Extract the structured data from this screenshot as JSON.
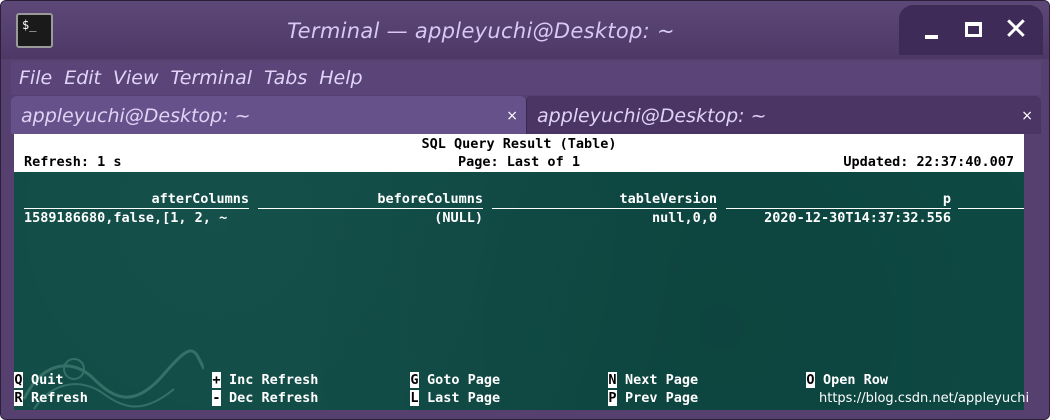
{
  "window": {
    "title": "Terminal — appleyuchi@Desktop: ~",
    "icon_text_line1": "$_",
    "icon_text_line2": "",
    "controls": {
      "minimize": "minimize-icon",
      "maximize": "maximize-icon",
      "close": "✕"
    }
  },
  "menu": [
    "File",
    "Edit",
    "View",
    "Terminal",
    "Tabs",
    "Help"
  ],
  "tabs": [
    {
      "label": "appleyuchi@Desktop: ~",
      "close": "×"
    },
    {
      "label": "appleyuchi@Desktop: ~",
      "close": "×"
    }
  ],
  "query_header": {
    "title": "SQL Query Result (Table)",
    "refresh": "Refresh: 1 s",
    "page": "Page: Last of 1",
    "updated": "Updated: 22:37:40.007"
  },
  "table": {
    "columns": [
      "afterColumns",
      "beforeColumns",
      "tableVersion",
      "p"
    ],
    "rows": [
      [
        "1589186680,false,[1, 2, ~",
        "(NULL)",
        "null,0,0",
        "2020-12-30T14:37:32.556"
      ]
    ]
  },
  "footer": {
    "keys": [
      {
        "key": "Q",
        "label": "Quit"
      },
      {
        "key": "R",
        "label": "Refresh"
      },
      {
        "key": "+",
        "label": "Inc Refresh"
      },
      {
        "key": "-",
        "label": "Dec Refresh"
      },
      {
        "key": "G",
        "label": "Goto Page"
      },
      {
        "key": "L",
        "label": "Last Page"
      },
      {
        "key": "N",
        "label": "Next Page"
      },
      {
        "key": "P",
        "label": "Prev Page"
      },
      {
        "key": "O",
        "label": "Open Row"
      }
    ]
  },
  "watermark": "https://blog.csdn.net/appleyuchi",
  "colors": {
    "frame": "#564070",
    "terminal_bg": "#0e4a44",
    "title_text": "#d8c8f5"
  }
}
